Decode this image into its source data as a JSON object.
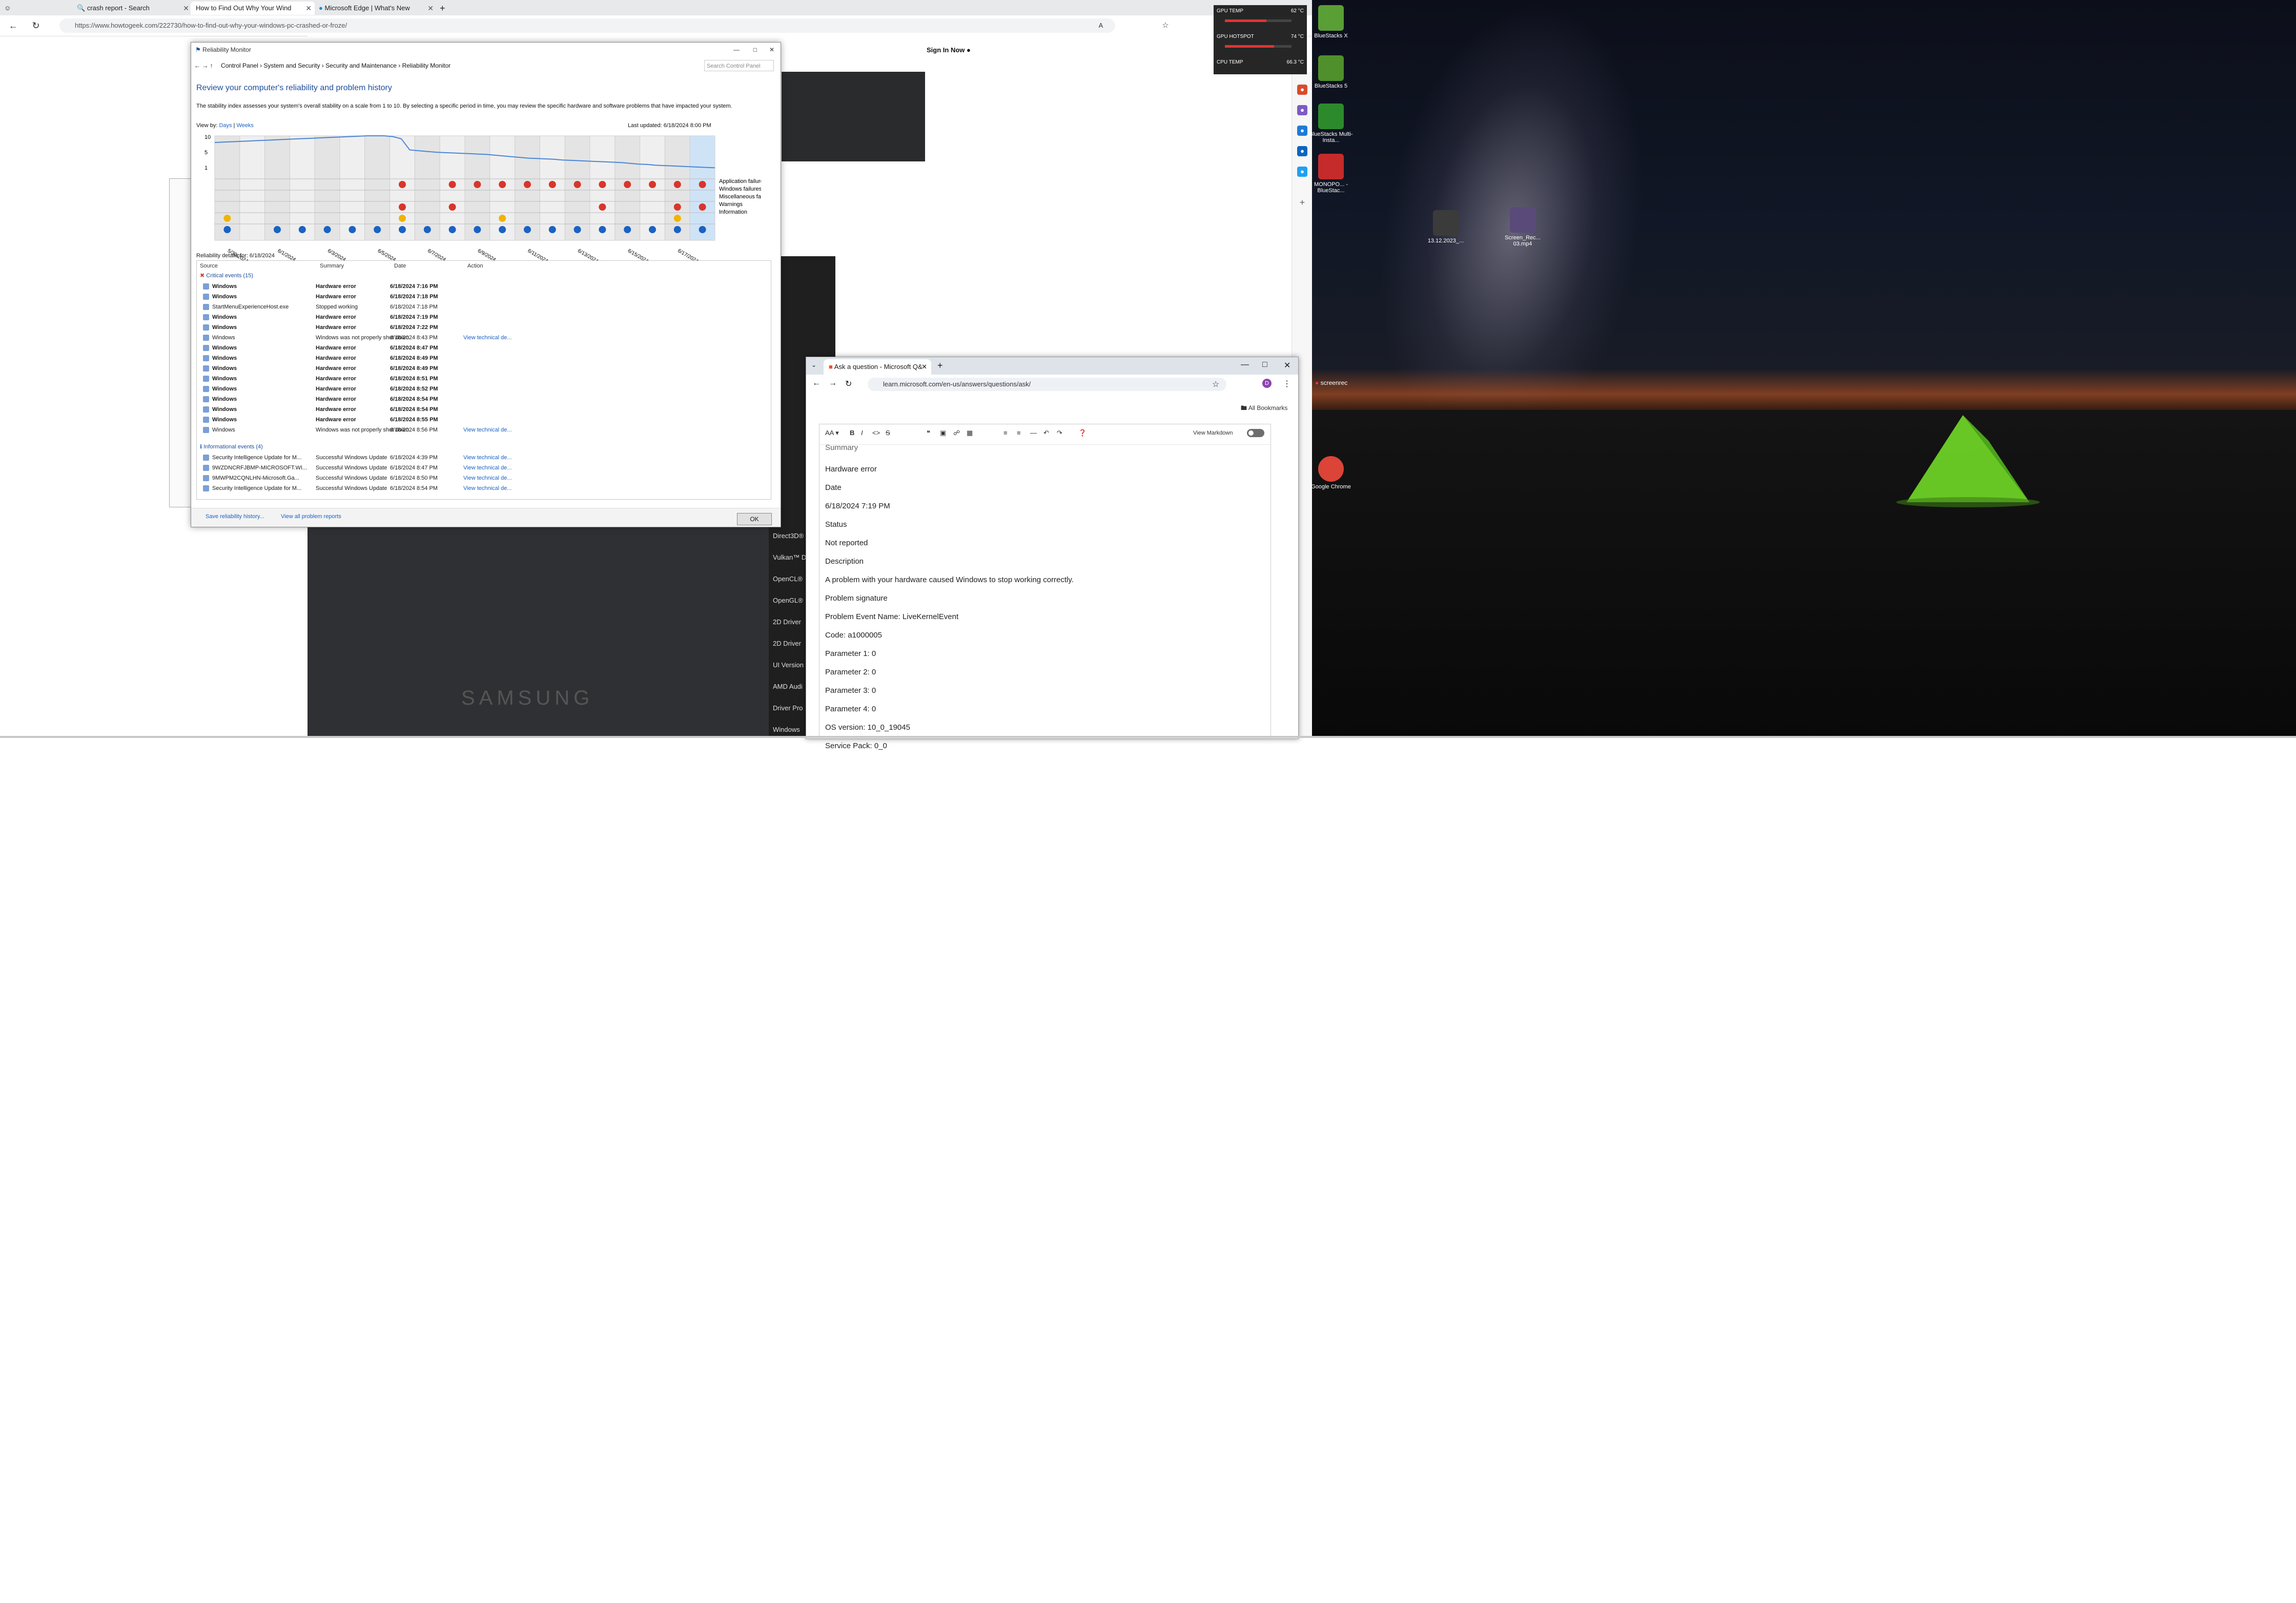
{
  "edge": {
    "tabs": [
      {
        "label": "crash report - Search"
      },
      {
        "label": "How to Find Out Why Your Wind"
      },
      {
        "label": "Microsoft Edge | What's New"
      }
    ],
    "url": "https://www.howtogeek.com/222730/how-to-find-out-why-your-windows-pc-crashed-or-froze/",
    "signin": "Sign In Now",
    "tech_panel": [
      "Direct3D®",
      "Vulkan™ D",
      "OpenCL®",
      "OpenGL®",
      "2D Driver",
      "2D Driver",
      "UI Version",
      "AMD Audi",
      "Driver Pro",
      "Windows"
    ],
    "article_image_text": "SAMSUNG"
  },
  "hwmonitor": {
    "rows": [
      {
        "label": "GPU TEMP",
        "value": "62 °C",
        "level": 0.62
      },
      {
        "label": "GPU HOTSPOT",
        "value": "74 °C",
        "level": 0.74
      },
      {
        "label": "CPU TEMP",
        "value": "66.3 °C",
        "level": 0.66
      }
    ]
  },
  "desktop": {
    "icons": [
      {
        "label": "BlueStacks X",
        "color": "#5a9e36"
      },
      {
        "label": "BlueStacks 5",
        "color": "#4f8f2c"
      },
      {
        "label": "BlueStacks Multi-Insta...",
        "color": "#2c8a2c"
      },
      {
        "label": "MONOPO... - BlueStac...",
        "color": "#c52b2b"
      },
      {
        "label": "13.12.2023_...",
        "color": "#3b3b3b"
      },
      {
        "label": "Screen_Rec... 03.mp4",
        "color": "#5a4a7a"
      },
      {
        "label": "Google Chrome",
        "color": "#db4437"
      }
    ],
    "screenrec_label": "screenrec"
  },
  "reliability": {
    "window_title": "Reliability Monitor",
    "breadcrumb": [
      "Control Panel",
      "System and Security",
      "Security and Maintenance",
      "Reliability Monitor"
    ],
    "search_placeholder": "Search Control Panel",
    "heading": "Review your computer's reliability and problem history",
    "description": "The stability index assesses your system's overall stability on a scale from 1 to 10. By selecting a specific period in time, you may review the specific hardware and software problems that have impacted your system.",
    "view_by_label": "View by:",
    "view_days": "Days",
    "view_weeks": "Weeks",
    "last_updated": "Last updated: 6/18/2024 8:00 PM",
    "chart_data": {
      "type": "line",
      "y_ticks": [
        "10",
        "5",
        "1"
      ],
      "x_labels": [
        "5/30/2024",
        "6/1/2024",
        "6/3/2024",
        "6/5/2024",
        "6/7/2024",
        "6/9/2024",
        "6/11/2024",
        "6/13/2024",
        "6/15/2024",
        "6/17/2024"
      ],
      "legend": [
        "Application failures",
        "Windows failures",
        "Miscellaneous failures",
        "Warnings",
        "Information"
      ],
      "stability": [
        8.2,
        8.3,
        8.4,
        8.5,
        8.6,
        8.7,
        8.8,
        8.9,
        9.0,
        9.1,
        9.2,
        9.3,
        9.4,
        9.5,
        9.6,
        9.7,
        9.8,
        9.9,
        10.0,
        10.0,
        10.0,
        9.8,
        9.2,
        6.2,
        6.0,
        5.8,
        5.6,
        5.5,
        5.4,
        5.3,
        5.2,
        5.1,
        5.0,
        4.8,
        4.6,
        4.4,
        4.2,
        4.0,
        3.9,
        3.8,
        3.7,
        3.5,
        3.4,
        3.3,
        3.2,
        3.1,
        3.0,
        2.9,
        2.8,
        2.6,
        2.4,
        2.3,
        2.1,
        2.0,
        1.9,
        1.8,
        1.7,
        1.6,
        1.5,
        1.4
      ]
    },
    "details_label": "Reliability details for: 6/18/2024",
    "columns": [
      "Source",
      "Summary",
      "Date",
      "Action"
    ],
    "critical_label": "Critical events (15)",
    "critical": [
      {
        "source": "Windows",
        "summary": "Hardware error",
        "date": "6/18/2024 7:16 PM",
        "action": ""
      },
      {
        "source": "Windows",
        "summary": "Hardware error",
        "date": "6/18/2024 7:18 PM",
        "action": ""
      },
      {
        "source": "StartMenuExperienceHost.exe",
        "summary": "Stopped working",
        "date": "6/18/2024 7:18 PM",
        "action": ""
      },
      {
        "source": "Windows",
        "summary": "Hardware error",
        "date": "6/18/2024 7:19 PM",
        "action": ""
      },
      {
        "source": "Windows",
        "summary": "Hardware error",
        "date": "6/18/2024 7:22 PM",
        "action": ""
      },
      {
        "source": "Windows",
        "summary": "Windows was not properly shut down",
        "date": "6/18/2024 8:43 PM",
        "action": "View technical de..."
      },
      {
        "source": "Windows",
        "summary": "Hardware error",
        "date": "6/18/2024 8:47 PM",
        "action": ""
      },
      {
        "source": "Windows",
        "summary": "Hardware error",
        "date": "6/18/2024 8:49 PM",
        "action": ""
      },
      {
        "source": "Windows",
        "summary": "Hardware error",
        "date": "6/18/2024 8:49 PM",
        "action": ""
      },
      {
        "source": "Windows",
        "summary": "Hardware error",
        "date": "6/18/2024 8:51 PM",
        "action": ""
      },
      {
        "source": "Windows",
        "summary": "Hardware error",
        "date": "6/18/2024 8:52 PM",
        "action": ""
      },
      {
        "source": "Windows",
        "summary": "Hardware error",
        "date": "6/18/2024 8:54 PM",
        "action": ""
      },
      {
        "source": "Windows",
        "summary": "Hardware error",
        "date": "6/18/2024 8:54 PM",
        "action": ""
      },
      {
        "source": "Windows",
        "summary": "Hardware error",
        "date": "6/18/2024 8:55 PM",
        "action": ""
      },
      {
        "source": "Windows",
        "summary": "Windows was not properly shut down",
        "date": "6/18/2024 8:56 PM",
        "action": "View technical de..."
      }
    ],
    "info_label": "Informational events (4)",
    "info": [
      {
        "source": "Security Intelligence Update for M...",
        "summary": "Successful Windows Update",
        "date": "6/18/2024 4:39 PM",
        "action": "View technical de..."
      },
      {
        "source": "9WZDNCRFJBMP-MICROSOFT.WI...",
        "summary": "Successful Windows Update",
        "date": "6/18/2024 8:47 PM",
        "action": "View technical de..."
      },
      {
        "source": "9MWPM2CQNLHN-Microsoft.Ga...",
        "summary": "Successful Windows Update",
        "date": "6/18/2024 8:50 PM",
        "action": "View technical de..."
      },
      {
        "source": "Security Intelligence Update for M...",
        "summary": "Successful Windows Update",
        "date": "6/18/2024 8:54 PM",
        "action": "View technical de..."
      }
    ],
    "save_history": "Save reliability history...",
    "view_all": "View all problem reports",
    "ok": "OK"
  },
  "chrome": {
    "tab_label": "Ask a question - Microsoft Q&",
    "url": "learn.microsoft.com/en-us/answers/questions/ask/",
    "bookmarks": "All Bookmarks",
    "view_markdown": "View Markdown",
    "profile_letter": "D",
    "editor_lines": [
      "Summary",
      "Hardware error",
      "Date",
      "6/18/2024 7:19 PM",
      "Status",
      "Not reported",
      "Description",
      "A problem with your hardware caused Windows to stop working correctly.",
      "Problem signature",
      "Problem Event Name:     LiveKernelEvent",
      "Code:     a1000005",
      "Parameter 1:   0",
      "Parameter 2:   0",
      "Parameter 3:   0",
      "Parameter 4:   0",
      "OS version:     10_0_19045",
      "Service Pack:   0_0"
    ]
  }
}
